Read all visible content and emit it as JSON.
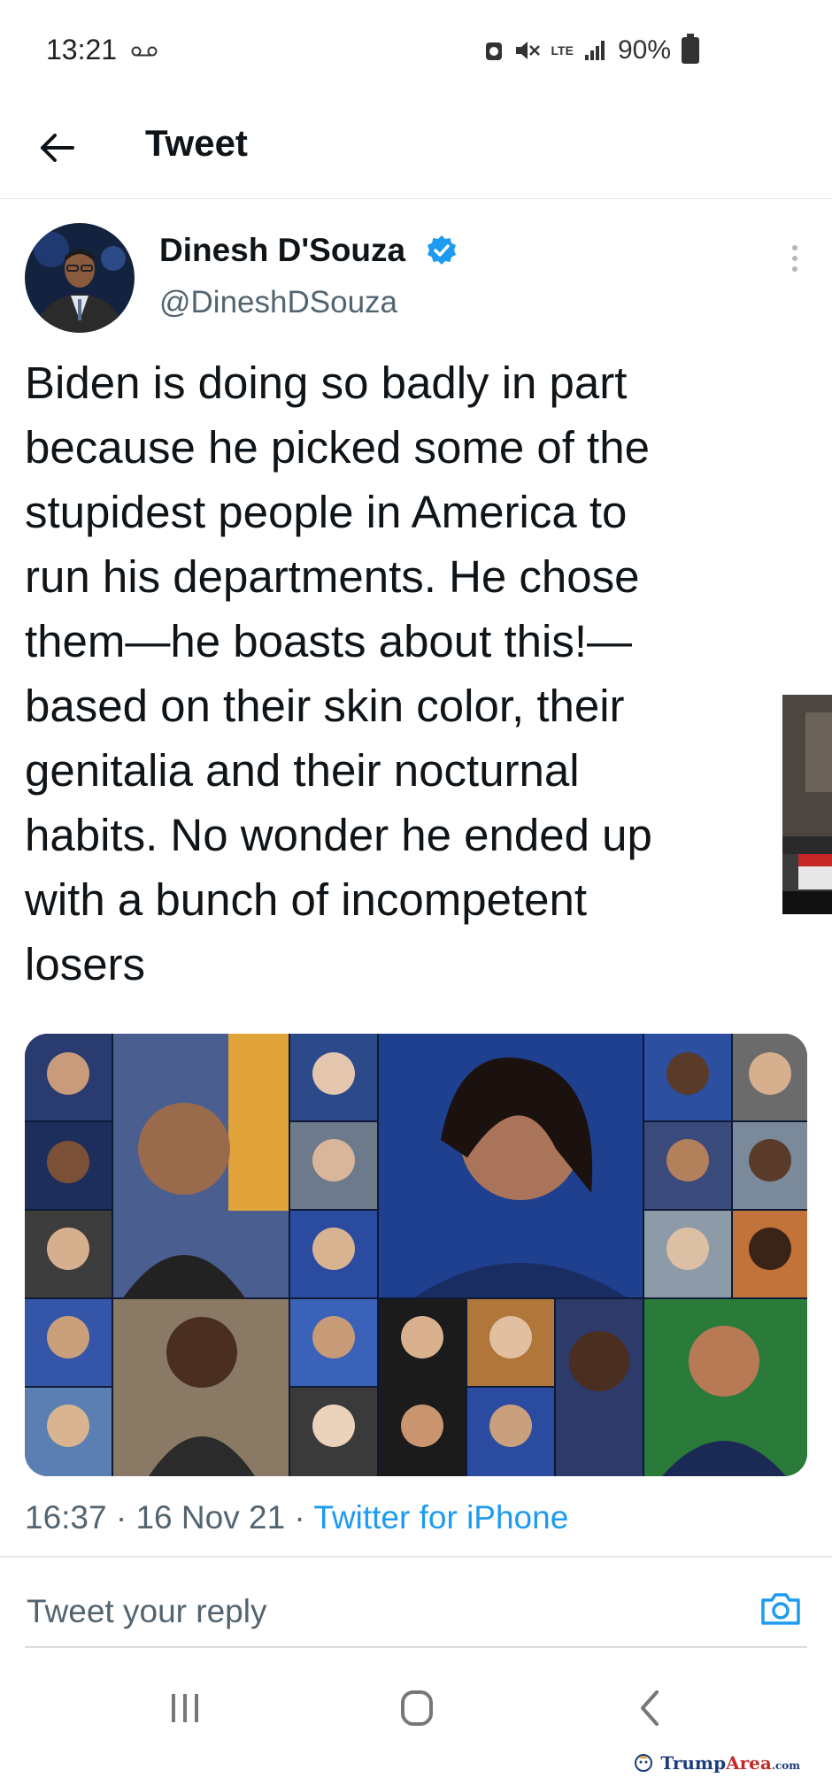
{
  "status_bar": {
    "time": "13:21",
    "network": "LTE",
    "battery_percent": "90%",
    "icons": [
      "voicemail-icon",
      "alarm-icon",
      "mute-icon",
      "lte-icon",
      "signal-icon",
      "battery-icon"
    ]
  },
  "header": {
    "title": "Tweet",
    "back_icon": "arrow-left-icon"
  },
  "tweet": {
    "author_name": "Dinesh D'Souza",
    "handle": "@DineshDSouza",
    "verified": true,
    "text": "Biden is doing so badly in part\nbecause he picked some of the\nstupidest people in America to\nrun his departments. He chose\nthem—he boasts about this!—\nbased on their skin color, their\ngenitalia and their nocturnal\nhabits. No wonder he ended up\nwith a bunch of incompetent\nlosers",
    "time": "16:37",
    "date": "16 Nov 21",
    "source": "Twitter for iPhone",
    "media_description_icon": "photo-collage-icon"
  },
  "reply": {
    "placeholder": "Tweet your reply",
    "camera_icon": "camera-icon"
  },
  "nav_bar": {
    "items": [
      "recent-apps-icon",
      "home-icon",
      "back-icon"
    ]
  },
  "watermark": {
    "brand_main": "Trump",
    "brand_accent": "Area",
    "brand_suffix": ".com"
  },
  "colors": {
    "accent": "#1d9bf0",
    "text": "#0f1419",
    "secondary_text": "#536471"
  }
}
